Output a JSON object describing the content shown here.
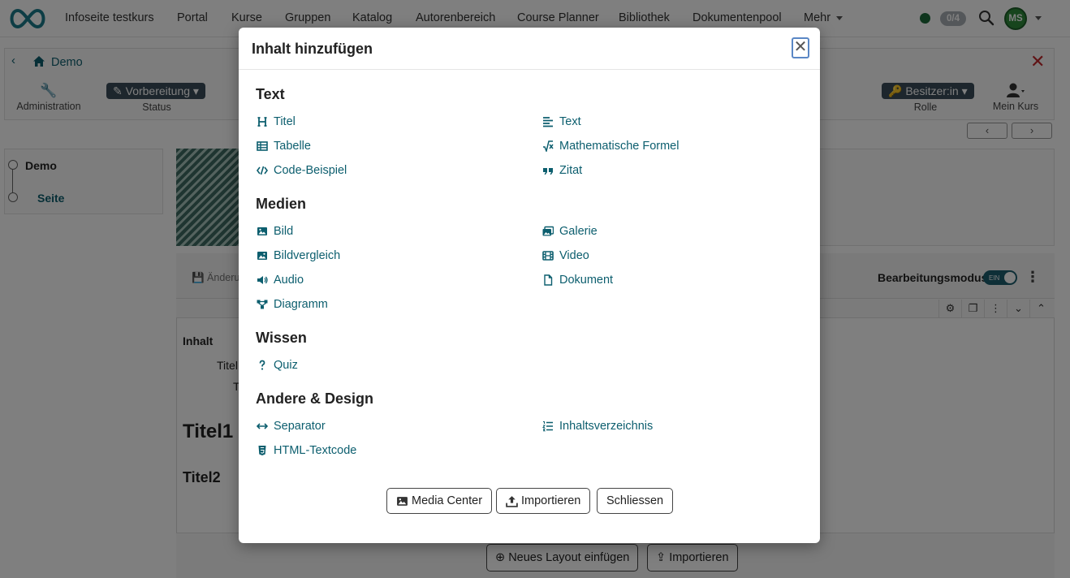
{
  "topnav": {
    "brand": "Infoseite testkurs",
    "items": [
      "Portal",
      "Kurse",
      "Gruppen",
      "Katalog",
      "Autorenbereich",
      "Course Planner",
      "Bibliothek",
      "Dokumentenpool",
      "Mehr"
    ],
    "count_badge": "0/4",
    "avatar_initials": "MS"
  },
  "breadcrumb": {
    "label": "Demo"
  },
  "toolbar": {
    "administration_label": "Administration",
    "status_value": "Vorbereitung",
    "status_label": "Status",
    "role_value": "Besitzer:in",
    "role_label": "Rolle",
    "my_course_label": "Mein Kurs"
  },
  "tree": {
    "root": "Demo",
    "child": "Seite"
  },
  "editor": {
    "save_text": "Änderun",
    "edit_mode_label": "Bearbeitungsmodus",
    "toggle_text": "EIN",
    "content_label": "Inhalt",
    "content_line_1": "Titel",
    "content_line_2": "T",
    "heading_1": "Titel1",
    "heading_2": "Titel2",
    "add_layout_button": "Neues Layout einfügen",
    "import_button": "Importieren"
  },
  "modal": {
    "title": "Inhalt hinzufügen",
    "close_symbol": "✕",
    "sections": {
      "text": {
        "title": "Text",
        "items": [
          "Titel",
          "Text",
          "Tabelle",
          "Mathematische Formel",
          "Code-Beispiel",
          "Zitat"
        ]
      },
      "media": {
        "title": "Medien",
        "items": [
          "Bild",
          "Galerie",
          "Bildvergleich",
          "Video",
          "Audio",
          "Dokument",
          "Diagramm"
        ]
      },
      "knowledge": {
        "title": "Wissen",
        "items": [
          "Quiz"
        ]
      },
      "other": {
        "title": "Andere & Design",
        "items": [
          "Separator",
          "Inhaltsverzeichnis",
          "HTML-Textcode"
        ]
      }
    },
    "buttons": {
      "media_center": "Media Center",
      "import": "Importieren",
      "close": "Schliessen"
    }
  },
  "colors": {
    "link": "#0c5e6e",
    "status_pill": "#3b4d5a",
    "danger": "#c0262b"
  }
}
